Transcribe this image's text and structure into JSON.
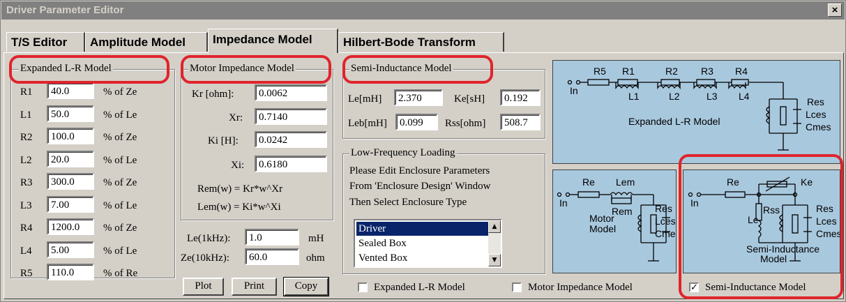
{
  "window": {
    "title": "Driver Parameter Editor",
    "close_label": "×"
  },
  "tabs": [
    {
      "label": "T/S Editor"
    },
    {
      "label": "Amplitude Model"
    },
    {
      "label": "Impedance Model"
    },
    {
      "label": "Hilbert-Bode Transform"
    }
  ],
  "active_tab": "Impedance Model",
  "expanded_lr": {
    "title": "Expanded L-R Model",
    "rows": [
      {
        "name": "R1",
        "value": "40.0",
        "unit": "% of Ze"
      },
      {
        "name": "L1",
        "value": "50.0",
        "unit": "% of Le"
      },
      {
        "name": "R2",
        "value": "100.0",
        "unit": "% of Ze"
      },
      {
        "name": "L2",
        "value": "20.0",
        "unit": "% of Le"
      },
      {
        "name": "R3",
        "value": "300.0",
        "unit": "% of Ze"
      },
      {
        "name": "L3",
        "value": "7.00",
        "unit": "% of Le"
      },
      {
        "name": "R4",
        "value": "1200.0",
        "unit": "% of Ze"
      },
      {
        "name": "L4",
        "value": "5.00",
        "unit": "% of Le"
      },
      {
        "name": "R5",
        "value": "110.0",
        "unit": "% of Re"
      }
    ]
  },
  "motor": {
    "title": "Motor Impedance Model",
    "kr_label": "Kr [ohm]:",
    "kr_value": "0.0062",
    "xr_label": "Xr:",
    "xr_value": "0.7140",
    "ki_label": "Ki [H]:",
    "ki_value": "0.0242",
    "xi_label": "Xi:",
    "xi_value": "0.6180",
    "rem_formula": "Rem(w) = Kr*w^Xr",
    "lem_formula": "Lem(w) = Ki*w^Xi"
  },
  "le_field": {
    "label": "Le(1kHz):",
    "value": "1.0",
    "unit": "mH"
  },
  "ze_field": {
    "label": "Ze(10kHz):",
    "value": "60.0",
    "unit": "ohm"
  },
  "buttons": {
    "plot": "Plot",
    "print": "Print",
    "copy": "Copy"
  },
  "semi": {
    "title": "Semi-Inductance Model",
    "le_label": "Le[mH]",
    "le_value": "2.370",
    "ke_label": "Ke[sH]",
    "ke_value": "0.192",
    "leb_label": "Leb[mH]",
    "leb_value": "0.099",
    "rss_label": "Rss[ohm]",
    "rss_value": "508.7"
  },
  "lowfreq": {
    "title": "Low-Frequency Loading",
    "text": [
      "Please Edit Enclosure Parameters",
      "From 'Enclosure Design' Window",
      "Then Select Enclosure Type"
    ],
    "options": [
      "Driver",
      "Sealed Box",
      "Vented Box"
    ],
    "selected": "Driver"
  },
  "checkboxes": [
    {
      "label": "Expanded L-R Model",
      "checked": false
    },
    {
      "label": "Motor Impedance Model",
      "checked": false
    },
    {
      "label": "Semi-Inductance Model",
      "checked": true
    }
  ],
  "diagrams": {
    "expanded": {
      "components": [
        "R5",
        "R1",
        "R2",
        "R3",
        "R4",
        "L1",
        "L2",
        "L3",
        "L4"
      ],
      "in": "In",
      "res": [
        "Res",
        "Lces",
        "Cmes"
      ],
      "caption": "Expanded L-R Model"
    },
    "motor": {
      "re": "Re",
      "lem": "Lem",
      "rem": "Rem",
      "in": "In",
      "caption": [
        "Motor",
        "Model"
      ],
      "res": [
        "Res",
        "Lces",
        "Cmes"
      ]
    },
    "semi": {
      "re": "Re",
      "ke": "Ke",
      "in": "In",
      "rss": "Rss",
      "le": "Le",
      "res": [
        "Res",
        "Lces",
        "Cmes"
      ],
      "caption": [
        "Semi-Inductance",
        "Model"
      ]
    }
  },
  "colors": {
    "diagram_bg": "#a8c8de",
    "highlight": "#e0242c",
    "selection": "#0a246a"
  }
}
